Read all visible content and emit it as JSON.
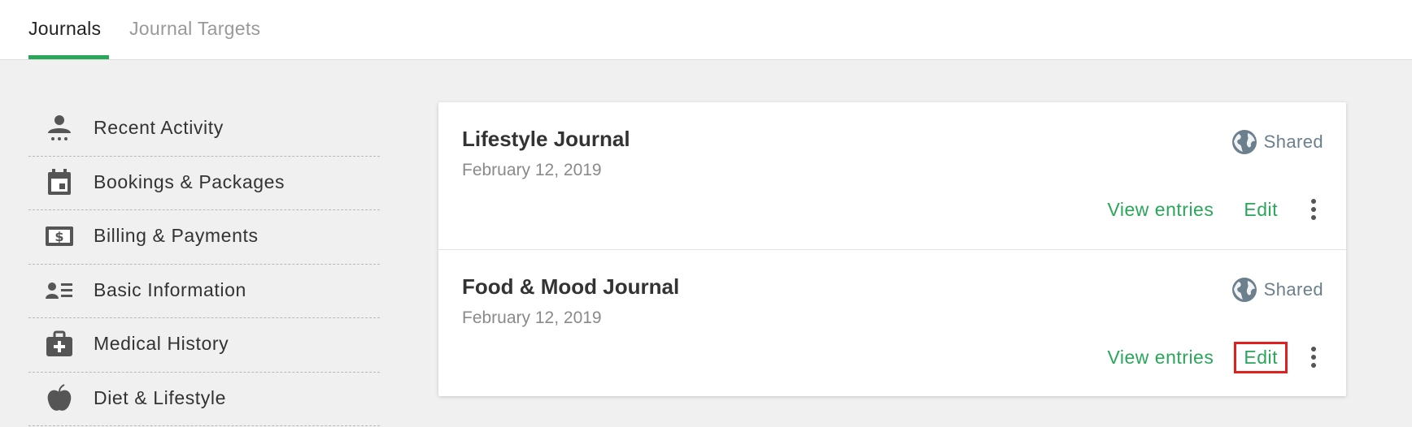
{
  "tabs": [
    {
      "label": "Journals",
      "active": true
    },
    {
      "label": "Journal Targets",
      "active": false
    }
  ],
  "sidebar": {
    "items": [
      {
        "label": "Recent Activity",
        "icon": "person-activity-icon"
      },
      {
        "label": "Bookings & Packages",
        "icon": "calendar-icon"
      },
      {
        "label": "Billing & Payments",
        "icon": "dollar-bill-icon"
      },
      {
        "label": "Basic Information",
        "icon": "contact-list-icon"
      },
      {
        "label": "Medical History",
        "icon": "medical-kit-icon"
      },
      {
        "label": "Diet & Lifestyle",
        "icon": "apple-icon"
      }
    ]
  },
  "journals": [
    {
      "title": "Lifestyle Journal",
      "date": "February 12, 2019",
      "shared_label": "Shared",
      "view_label": "View entries",
      "edit_label": "Edit"
    },
    {
      "title": "Food & Mood Journal",
      "date": "February 12, 2019",
      "shared_label": "Shared",
      "view_label": "View entries",
      "edit_label": "Edit"
    }
  ],
  "colors": {
    "accent": "#2aa65a",
    "shared_text": "#6b7f8c",
    "highlight": "#e0201e"
  }
}
